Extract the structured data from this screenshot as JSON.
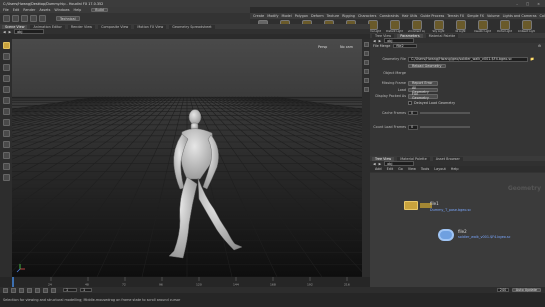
{
  "window": {
    "title": "C:/Users/Hwang/Desktop/Dummy.hip - Houdini FX 17.0.352"
  },
  "menubar": {
    "items": [
      "File",
      "Edit",
      "Render",
      "Assets",
      "Windows",
      "Help"
    ],
    "build": "Build"
  },
  "toolbar": {
    "desktop": "Technical"
  },
  "shelf": {
    "tabs": [
      "Create",
      "Modify",
      "Model",
      "Polygon",
      "Deform",
      "Texture",
      "Rigging",
      "Characters",
      "Constraints",
      "Hair Utils",
      "Guide Process",
      "Terrain FX",
      "Simple FX",
      "Volume",
      "Lights and Cameras",
      "Collisions",
      "Particles",
      "Grains"
    ],
    "tools": [
      "Camera",
      "Point Light",
      "Spot Light",
      "Area Light",
      "Geometry Light",
      "Volume Light",
      "Distant Light",
      "Environment Light",
      "Sky Light",
      "GI Light",
      "Caustic Light",
      "Portal Light",
      "Ambient Light"
    ]
  },
  "left_panel": {
    "tabs": [
      "Scene View",
      "Animation Editor",
      "Render View",
      "Composite View",
      "Motion FX View",
      "Geometry Spreadsheet"
    ],
    "path": "obj"
  },
  "viewport": {
    "camera": "Persp",
    "cam_menu": "No cam"
  },
  "timeline": {
    "start": "1",
    "end": "240",
    "current": "1",
    "ticks": [
      "24",
      "48",
      "72",
      "96",
      "120",
      "144",
      "168",
      "192",
      "216"
    ]
  },
  "status": {
    "text": "Selection for viewing and structural modelling; Middle-mousedrag on frame state to scroll around cursor",
    "auto_update": "Auto Update"
  },
  "params": {
    "tabs": [
      "Tree View",
      "Parameters",
      "Material Palette"
    ],
    "path": "obj",
    "node_type": "File Merge",
    "node_name": "file2",
    "geometry_file_label": "Geometry File",
    "geometry_file": "C:/Users/Hwang/Hwang/geo/soldier_walk_v001.$F4.bgeo.sc",
    "reload_label": "Reload Geometry",
    "object_merge": "Object Merge",
    "missing_frame_label": "Missing Frame",
    "missing_frame": "Report Error",
    "load_label": "Load",
    "load": "All Geometry",
    "display_packed_label": "Display Packed As",
    "display_packed": "Full Geometry",
    "delayed_label": "Delayed Load Geometry",
    "cache_label": "Cache Frames",
    "cache_value": "0",
    "count_label": "Count Load Frames",
    "count_value": "0"
  },
  "network": {
    "tabs": [
      "Tree View",
      "Material Palette",
      "Asset Browser"
    ],
    "path": "obj",
    "menus": [
      "Add",
      "Edit",
      "Go",
      "View",
      "Tools",
      "Layout",
      "Help"
    ],
    "context_label": "Geometry",
    "nodes": [
      {
        "name": "file1",
        "file": "Dummy_T_pose.bgeo.sc"
      },
      {
        "name": "file2",
        "file": "soldier_walk_v001.$F4.bgeo.sc"
      }
    ]
  },
  "colors": {
    "accent": "#c9a33d",
    "selected_node": "#4a7ab8",
    "text_link": "#7aa7ff"
  }
}
